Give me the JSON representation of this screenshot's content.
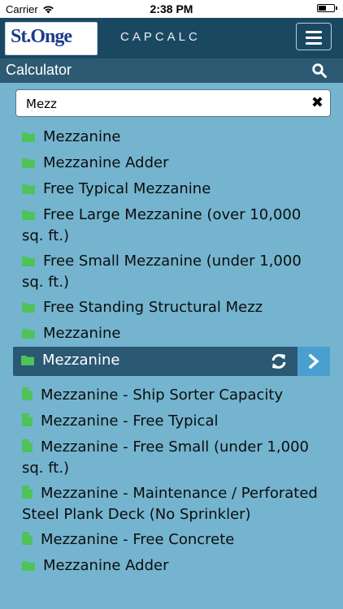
{
  "status": {
    "carrier": "Carrier",
    "time": "2:38 PM"
  },
  "header": {
    "logo_text": "St.Onge",
    "title": "CAPCALC",
    "menu_icon": "hamburger-menu-icon"
  },
  "subheader": {
    "label": "Calculator",
    "search_icon": "search-icon"
  },
  "search": {
    "value": "Mezz"
  },
  "colors": {
    "folder": "#4fc25a",
    "doc": "#4fc25a",
    "selected_bg": "#2b5873",
    "go_bg": "#4a9fd0"
  },
  "results": [
    {
      "type": "folder",
      "label": "Mezzanine"
    },
    {
      "type": "folder",
      "label": "Mezzanine Adder"
    },
    {
      "type": "folder",
      "label": "Free Typical Mezzanine"
    },
    {
      "type": "folder",
      "label": "Free Large Mezzanine (over 10,000 sq. ft.)"
    },
    {
      "type": "folder",
      "label": "Free Small Mezzanine (under 1,000 sq. ft.)"
    },
    {
      "type": "folder",
      "label": "Free Standing Structural Mezz"
    },
    {
      "type": "folder",
      "label": "Mezzanine"
    },
    {
      "type": "folder",
      "label": "Mezzanine",
      "selected": true
    },
    {
      "type": "doc",
      "label": "Mezzanine - Ship Sorter Capacity"
    },
    {
      "type": "doc",
      "label": "Mezzanine - Free Typical"
    },
    {
      "type": "doc",
      "label": "Mezzanine - Free Small (under 1,000 sq. ft.)"
    },
    {
      "type": "doc",
      "label": "Mezzanine - Maintenance / Perforated Steel Plank Deck (No Sprinkler)"
    },
    {
      "type": "doc",
      "label": "Mezzanine - Free Concrete"
    },
    {
      "type": "folder",
      "label": "Mezzanine Adder"
    }
  ]
}
